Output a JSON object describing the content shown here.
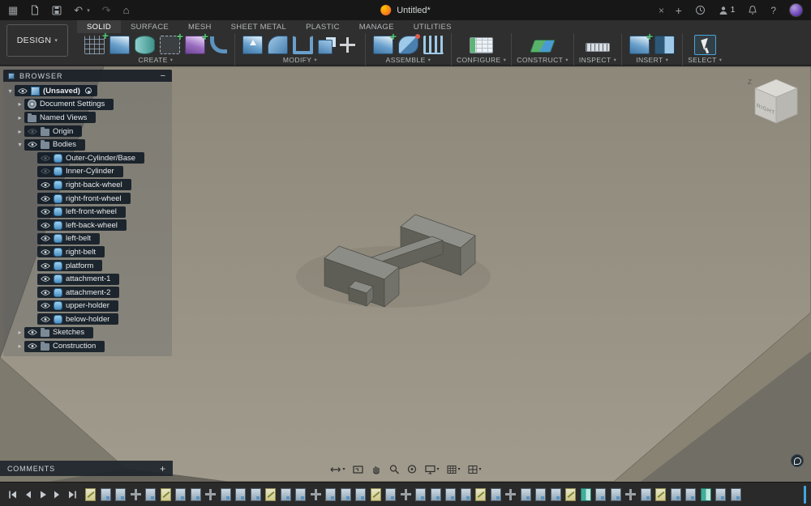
{
  "title_bar": {
    "title": "Untitled*",
    "close_tab_glyph": "×",
    "add_tab_glyph": "+",
    "collab_count": "1",
    "help_glyph": "?"
  },
  "toolbar": {
    "design_label": "DESIGN",
    "caret": "▾",
    "tabs": [
      {
        "label": "SOLID",
        "cls": "active"
      },
      {
        "label": "SURFACE",
        "cls": ""
      },
      {
        "label": "MESH",
        "cls": ""
      },
      {
        "label": "SHEET METAL",
        "cls": ""
      },
      {
        "label": "PLASTIC",
        "cls": ""
      },
      {
        "label": "MANAGE",
        "cls": ""
      },
      {
        "label": "UTILITIES",
        "cls": ""
      }
    ],
    "groups": [
      {
        "label": "CREATE",
        "icons": [
          "i-sketchgrid",
          "i-extrude",
          "i-cyl",
          "i-dashplus",
          "i-purple",
          "i-pipe"
        ]
      },
      {
        "label": "MODIFY",
        "icons": [
          "i-press",
          "i-fillet",
          "i-shell",
          "i-combine",
          "i-move"
        ]
      },
      {
        "label": "ASSEMBLE",
        "icons": [
          "i-newcomp",
          "i-joint",
          "i-chart"
        ]
      },
      {
        "label": "CONFIGURE",
        "icons": [
          "i-table"
        ]
      },
      {
        "label": "CONSTRUCT",
        "icons": [
          "i-plane"
        ]
      },
      {
        "label": "INSPECT",
        "icons": [
          "i-measure"
        ]
      },
      {
        "label": "INSERT",
        "icons": [
          "i-insert",
          "i-canvas"
        ]
      },
      {
        "label": "SELECT",
        "icons": [
          "i-cursor"
        ]
      }
    ]
  },
  "browser": {
    "header": "BROWSER",
    "minimize_glyph": "−",
    "rows": [
      {
        "label": "(Unsaved)",
        "level": "lvl0",
        "arrow": "arr-down",
        "eye": "eye-on",
        "icon": "nic-comp",
        "extra": "extra-circle",
        "bold": "bold"
      },
      {
        "label": "Document Settings",
        "level": "lvl1",
        "arrow": "arr-right",
        "eye": "eye-none",
        "icon": "nic-gear",
        "extra": "",
        "bold": ""
      },
      {
        "label": "Named Views",
        "level": "lvl1",
        "arrow": "arr-right",
        "eye": "eye-none",
        "icon": "nic-folder",
        "extra": "",
        "bold": ""
      },
      {
        "label": "Origin",
        "level": "lvl1",
        "arrow": "arr-right",
        "eye": "eye-off",
        "icon": "nic-folder",
        "extra": "",
        "bold": ""
      },
      {
        "label": "Bodies",
        "level": "lvl1",
        "arrow": "arr-down",
        "eye": "eye-on",
        "icon": "nic-folder",
        "extra": "",
        "bold": ""
      },
      {
        "label": "Outer-Cylinder/Base",
        "level": "lvl2",
        "arrow": "arr-none",
        "eye": "eye-off",
        "icon": "nic-body",
        "extra": "",
        "bold": ""
      },
      {
        "label": "Inner-Cylinder",
        "level": "lvl2",
        "arrow": "arr-none",
        "eye": "eye-off",
        "icon": "nic-body",
        "extra": "",
        "bold": ""
      },
      {
        "label": "right-back-wheel",
        "level": "lvl2",
        "arrow": "arr-none",
        "eye": "eye-on",
        "icon": "nic-body",
        "extra": "",
        "bold": ""
      },
      {
        "label": "right-front-wheel",
        "level": "lvl2",
        "arrow": "arr-none",
        "eye": "eye-on",
        "icon": "nic-body",
        "extra": "",
        "bold": ""
      },
      {
        "label": "left-front-wheel",
        "level": "lvl2",
        "arrow": "arr-none",
        "eye": "eye-on",
        "icon": "nic-body",
        "extra": "",
        "bold": ""
      },
      {
        "label": "left-back-wheel",
        "level": "lvl2",
        "arrow": "arr-none",
        "eye": "eye-on",
        "icon": "nic-body",
        "extra": "",
        "bold": ""
      },
      {
        "label": "left-belt",
        "level": "lvl2",
        "arrow": "arr-none",
        "eye": "eye-on",
        "icon": "nic-body",
        "extra": "",
        "bold": ""
      },
      {
        "label": "right-belt",
        "level": "lvl2",
        "arrow": "arr-none",
        "eye": "eye-on",
        "icon": "nic-body",
        "extra": "",
        "bold": ""
      },
      {
        "label": "platform",
        "level": "lvl2",
        "arrow": "arr-none",
        "eye": "eye-on",
        "icon": "nic-body",
        "extra": "",
        "bold": ""
      },
      {
        "label": "attachment-1",
        "level": "lvl2",
        "arrow": "arr-none",
        "eye": "eye-on",
        "icon": "nic-body",
        "extra": "",
        "bold": ""
      },
      {
        "label": "attachment-2",
        "level": "lvl2",
        "arrow": "arr-none",
        "eye": "eye-on",
        "icon": "nic-body",
        "extra": "",
        "bold": ""
      },
      {
        "label": "upper-holder",
        "level": "lvl2",
        "arrow": "arr-none",
        "eye": "eye-on",
        "icon": "nic-body",
        "extra": "",
        "bold": ""
      },
      {
        "label": "below-holder",
        "level": "lvl2",
        "arrow": "arr-none",
        "eye": "eye-on",
        "icon": "nic-body",
        "extra": "",
        "bold": ""
      },
      {
        "label": "Sketches",
        "level": "lvl1",
        "arrow": "arr-right",
        "eye": "eye-on",
        "icon": "nic-folder",
        "extra": "",
        "bold": ""
      },
      {
        "label": "Construction",
        "level": "lvl1",
        "arrow": "arr-right",
        "eye": "eye-on",
        "icon": "nic-folder",
        "extra": "",
        "bold": ""
      }
    ]
  },
  "viewport": {
    "viewcube_face": "RIGHT",
    "axis_z": "Z"
  },
  "comments_bar": {
    "label": "COMMENTS",
    "add_glyph": "+"
  },
  "navbar": {
    "icons": [
      "fit-arrows-icon",
      "zoom-window-icon",
      "pan-hand-icon",
      "zoom-icon",
      "orbit-icon",
      "display-settings-icon",
      "grid-snap-icon",
      "viewports-icon"
    ]
  },
  "timeline": {
    "features": [
      {
        "t": "tl-sketch"
      },
      {
        "t": "tl-feature"
      },
      {
        "t": "tl-feature"
      },
      {
        "t": "tl-move"
      },
      {
        "t": "tl-feature"
      },
      {
        "t": "tl-sketch"
      },
      {
        "t": "tl-feature"
      },
      {
        "t": "tl-feature"
      },
      {
        "t": "tl-move"
      },
      {
        "t": "tl-feature"
      },
      {
        "t": "tl-feature"
      },
      {
        "t": "tl-feature"
      },
      {
        "t": "tl-sketch"
      },
      {
        "t": "tl-feature"
      },
      {
        "t": "tl-feature"
      },
      {
        "t": "tl-move"
      },
      {
        "t": "tl-feature"
      },
      {
        "t": "tl-feature"
      },
      {
        "t": "tl-feature"
      },
      {
        "t": "tl-sketch"
      },
      {
        "t": "tl-feature"
      },
      {
        "t": "tl-move"
      },
      {
        "t": "tl-feature"
      },
      {
        "t": "tl-feature"
      },
      {
        "t": "tl-feature"
      },
      {
        "t": "tl-feature"
      },
      {
        "t": "tl-sketch"
      },
      {
        "t": "tl-feature"
      },
      {
        "t": "tl-move"
      },
      {
        "t": "tl-feature"
      },
      {
        "t": "tl-feature"
      },
      {
        "t": "tl-feature"
      },
      {
        "t": "tl-sketch"
      },
      {
        "t": "tl-mirror"
      },
      {
        "t": "tl-feature"
      },
      {
        "t": "tl-feature"
      },
      {
        "t": "tl-move"
      },
      {
        "t": "tl-feature"
      },
      {
        "t": "tl-sketch"
      },
      {
        "t": "tl-feature"
      },
      {
        "t": "tl-feature"
      },
      {
        "t": "tl-mirror"
      },
      {
        "t": "tl-feature"
      },
      {
        "t": "tl-feature"
      }
    ]
  }
}
